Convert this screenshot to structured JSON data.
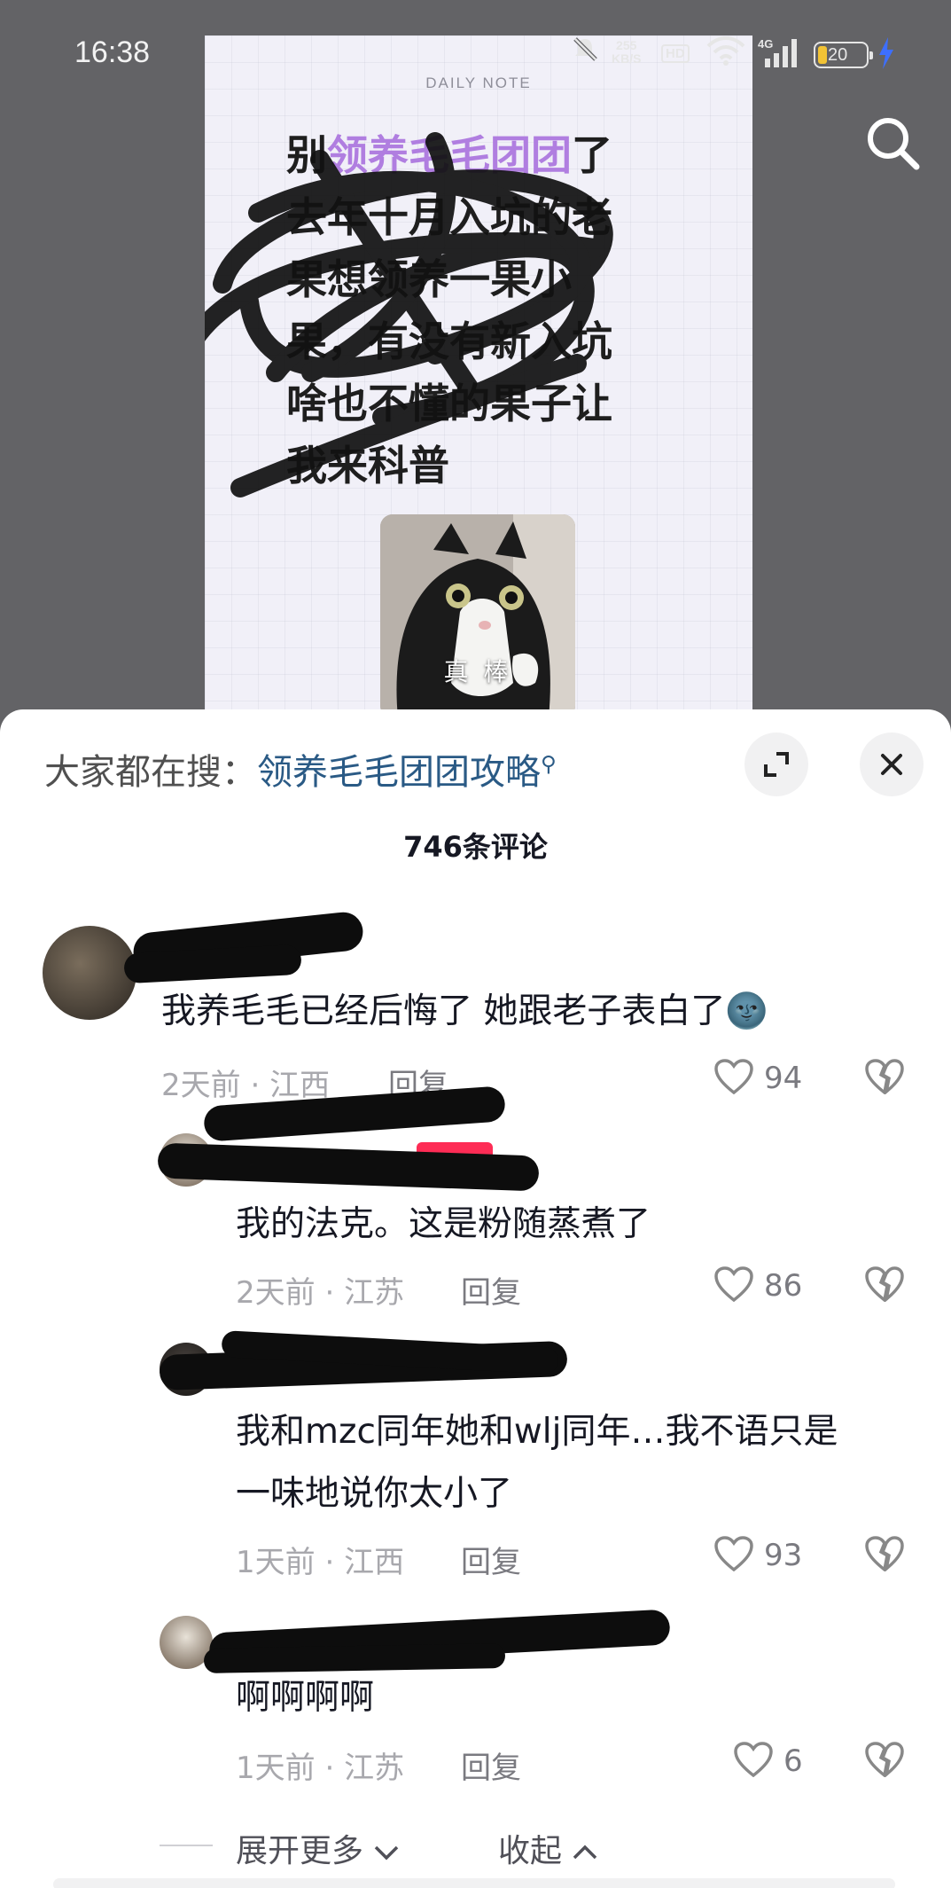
{
  "status_bar": {
    "time": "16:38",
    "net_speed_value": "255",
    "net_speed_unit": "KB/S",
    "hd_label": "HD",
    "cell_label": "4G",
    "battery_level": "20",
    "icons": [
      "mute-icon",
      "wifi-icon",
      "signal-icon",
      "battery-icon",
      "charging-icon"
    ]
  },
  "video": {
    "note_label": "DAILY NOTE",
    "note_lines": [
      "别领养毛毛团团了",
      "去年十月入坑的老",
      "果想领养一果小",
      "果，有没有新入坑",
      "啥也不懂的果子让",
      "我来科普"
    ],
    "note_highlight": "领养毛毛团团",
    "cat_caption": "真 棒",
    "search_icon": "search-icon"
  },
  "sheet": {
    "search_prefix": "大家都在搜：",
    "search_keyword": "领养毛毛团团攻略",
    "comment_count": "746条评论",
    "accent_color": "#fe2c55",
    "link_color": "#2a5a85"
  },
  "comments": [
    {
      "text": "我养毛毛已经后悔了 她跟老子表白了🌚",
      "time": "2天前",
      "location": "江西",
      "reply": "回复",
      "likes": "94"
    },
    {
      "text": "我的法克。这是粉随蒸煮了",
      "time": "2天前",
      "location": "江苏",
      "reply": "回复",
      "likes": "86"
    },
    {
      "text_line1": "我和mzc同年她和wlj同年…我不语只是",
      "text_line2": "一味地说你太小了",
      "time": "1天前",
      "location": "江西",
      "reply": "回复",
      "likes": "93"
    },
    {
      "text": "啊啊啊啊",
      "time": "1天前",
      "location": "江苏",
      "reply": "回复",
      "likes": "6"
    }
  ],
  "footer": {
    "expand_more": "展开更多",
    "collapse": "收起"
  }
}
